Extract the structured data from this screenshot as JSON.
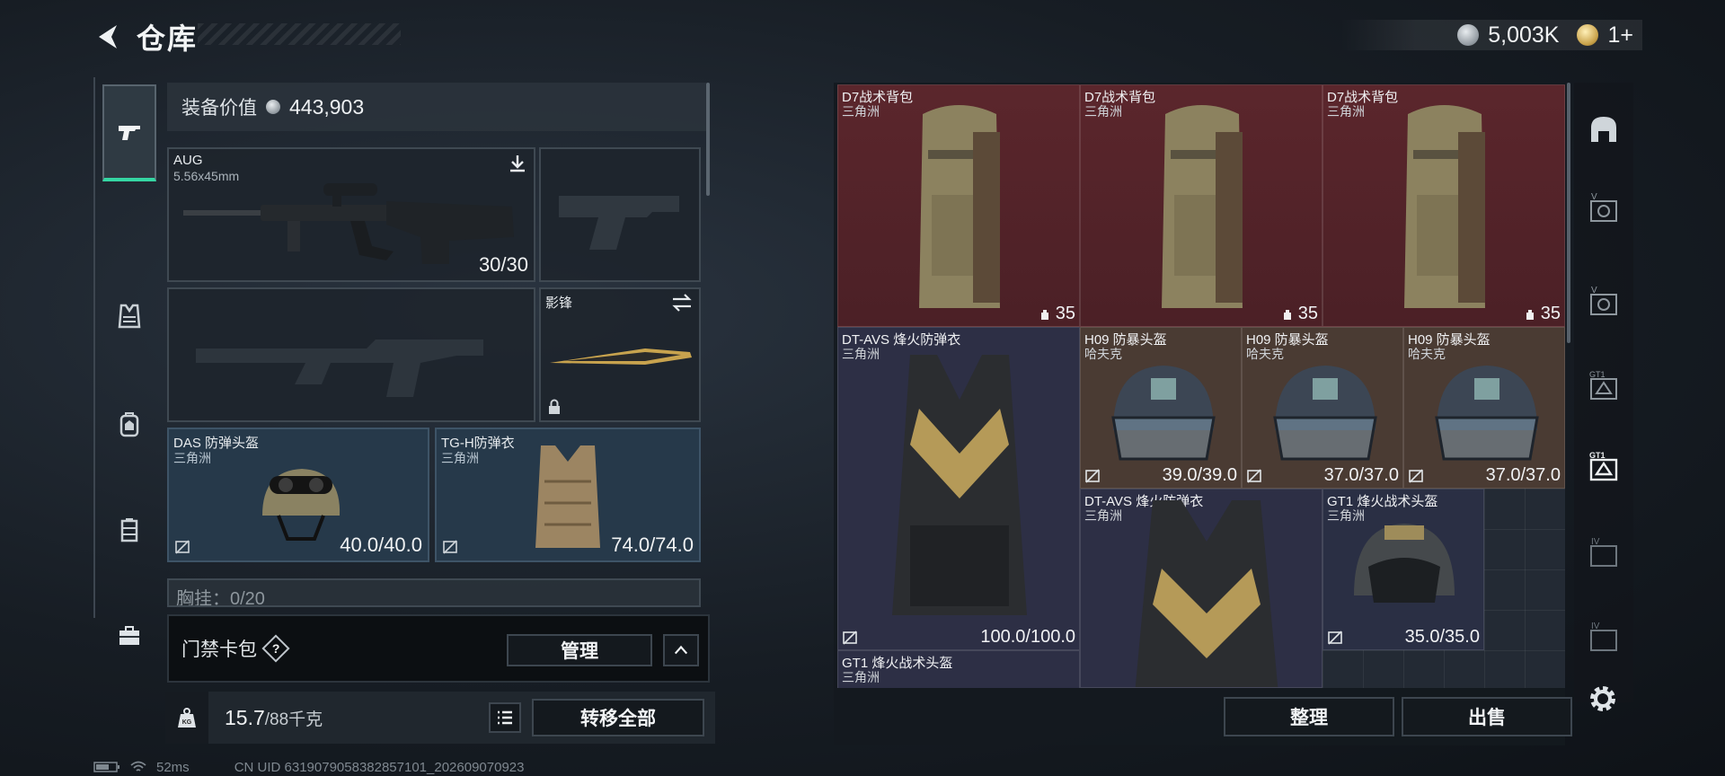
{
  "header": {
    "title": "仓库"
  },
  "currency": {
    "silver_value": "5,003K",
    "gold_value": "1+"
  },
  "left_tabs": [
    {
      "name": "weapon-tab",
      "icon": "pistol-icon",
      "active": true
    },
    {
      "name": "armor-tab",
      "icon": "vest-icon",
      "active": false
    },
    {
      "name": "backpack-tab",
      "icon": "backpack-icon",
      "active": false
    },
    {
      "name": "rig-tab",
      "icon": "rig-icon",
      "active": false
    },
    {
      "name": "case-tab",
      "icon": "briefcase-icon",
      "active": false
    }
  ],
  "loadout": {
    "equip_value_label": "装备价值",
    "equip_value": "443,903",
    "primary": {
      "name": "AUG",
      "caliber": "5.56x45mm",
      "ammo": "30/30",
      "icon": "download-icon"
    },
    "melee": {
      "name": "影锋",
      "icon": "swap-icon",
      "lock_icon": "lock-icon"
    },
    "helmet": {
      "name": "DAS 防弹头盔",
      "brand": "三角洲",
      "durability": "40.0/40.0"
    },
    "armor": {
      "name": "TG-H防弹衣",
      "brand": "三角洲",
      "durability": "74.0/74.0"
    },
    "chest_rig_peek": "胸挂：0/20"
  },
  "keybag": {
    "label": "门禁卡包",
    "help": "?",
    "manage_label": "管理"
  },
  "weight": {
    "current": "15.7",
    "max": "/88千克",
    "kg_label": "KG",
    "transfer_all_label": "转移全部"
  },
  "status": {
    "ping": "52ms",
    "uid": "CN UID 6319079058382857101_202609070923"
  },
  "storage": {
    "items": [
      {
        "name": "D7战术背包",
        "brand": "三角洲",
        "stat": "35",
        "color": "red"
      },
      {
        "name": "D7战术背包",
        "brand": "三角洲",
        "stat": "35",
        "color": "red"
      },
      {
        "name": "D7战术背包",
        "brand": "三角洲",
        "stat": "35",
        "color": "red"
      },
      {
        "name": "DT-AVS 烽火防弹衣",
        "brand": "三角洲",
        "stat": "100.0/100.0",
        "color": "purple"
      },
      {
        "name": "H09 防暴头盔",
        "brand": "哈夫克",
        "stat": "39.0/39.0",
        "color": "brown"
      },
      {
        "name": "H09 防暴头盔",
        "brand": "哈夫克",
        "stat": "37.0/37.0",
        "color": "brown"
      },
      {
        "name": "H09 防暴头盔",
        "brand": "哈夫克",
        "stat": "37.0/37.0",
        "color": "brown"
      },
      {
        "name": "DT-AVS 烽火防弹衣",
        "brand": "三角洲",
        "stat": "",
        "color": "purple"
      },
      {
        "name": "GT1 烽火战术头盔",
        "brand": "三角洲",
        "stat": "35.0/35.0",
        "color": "navy"
      },
      {
        "name": "GT1 烽火战术头盔",
        "brand": "三角洲",
        "stat": "",
        "color": "purple"
      }
    ],
    "sort_label": "整理",
    "sell_label": "出售"
  },
  "right_tabs": [
    "helmet-slot-icon",
    "container-v-icon",
    "container-v-icon",
    "container-gt1-icon",
    "container-gt1-active-icon",
    "container-iv-icon",
    "container-iv-icon",
    "gear-icon"
  ]
}
